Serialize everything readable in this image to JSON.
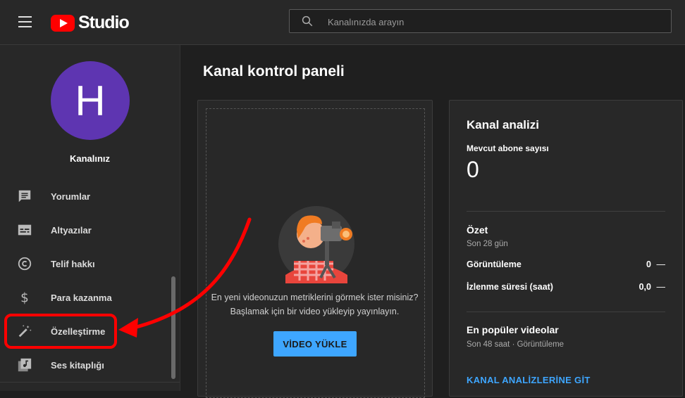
{
  "header": {
    "logo_text": "Studio",
    "search_placeholder": "Kanalınızda arayın"
  },
  "sidebar": {
    "avatar_letter": "H",
    "channel_label": "Kanalınız",
    "items": [
      {
        "label": "Yorumlar",
        "icon": "comment-icon"
      },
      {
        "label": "Altyazılar",
        "icon": "subtitles-icon"
      },
      {
        "label": "Telif hakkı",
        "icon": "copyright-icon"
      },
      {
        "label": "Para kazanma",
        "icon": "dollar-icon"
      },
      {
        "label": "Özelleştirme",
        "icon": "magic-wand-icon"
      },
      {
        "label": "Ses kitaplığı",
        "icon": "audio-library-icon"
      }
    ]
  },
  "main": {
    "title": "Kanal kontrol paneli",
    "upload_card": {
      "text_line1": "En yeni videonuzun metriklerini görmek ister misiniz?",
      "text_line2": "Başlamak için bir video yükleyip yayınlayın.",
      "button_label": "VİDEO YÜKLE"
    },
    "analytics": {
      "title": "Kanal analizi",
      "subscribers_label": "Mevcut abone sayısı",
      "subscribers_value": "0",
      "summary_title": "Özet",
      "summary_period": "Son 28 gün",
      "rows": [
        {
          "label": "Görüntüleme",
          "value": "0",
          "trend": "—"
        },
        {
          "label": "İzlenme süresi (saat)",
          "value": "0,0",
          "trend": "—"
        }
      ],
      "top_videos_title": "En popüler videolar",
      "top_videos_period": "Son 48 saat · Görüntüleme",
      "link_label": "KANAL ANALİZLERİNE GİT"
    }
  },
  "colors": {
    "accent": "#3ea6ff",
    "annotation": "#ff0000",
    "avatar": "#5e35b1"
  }
}
